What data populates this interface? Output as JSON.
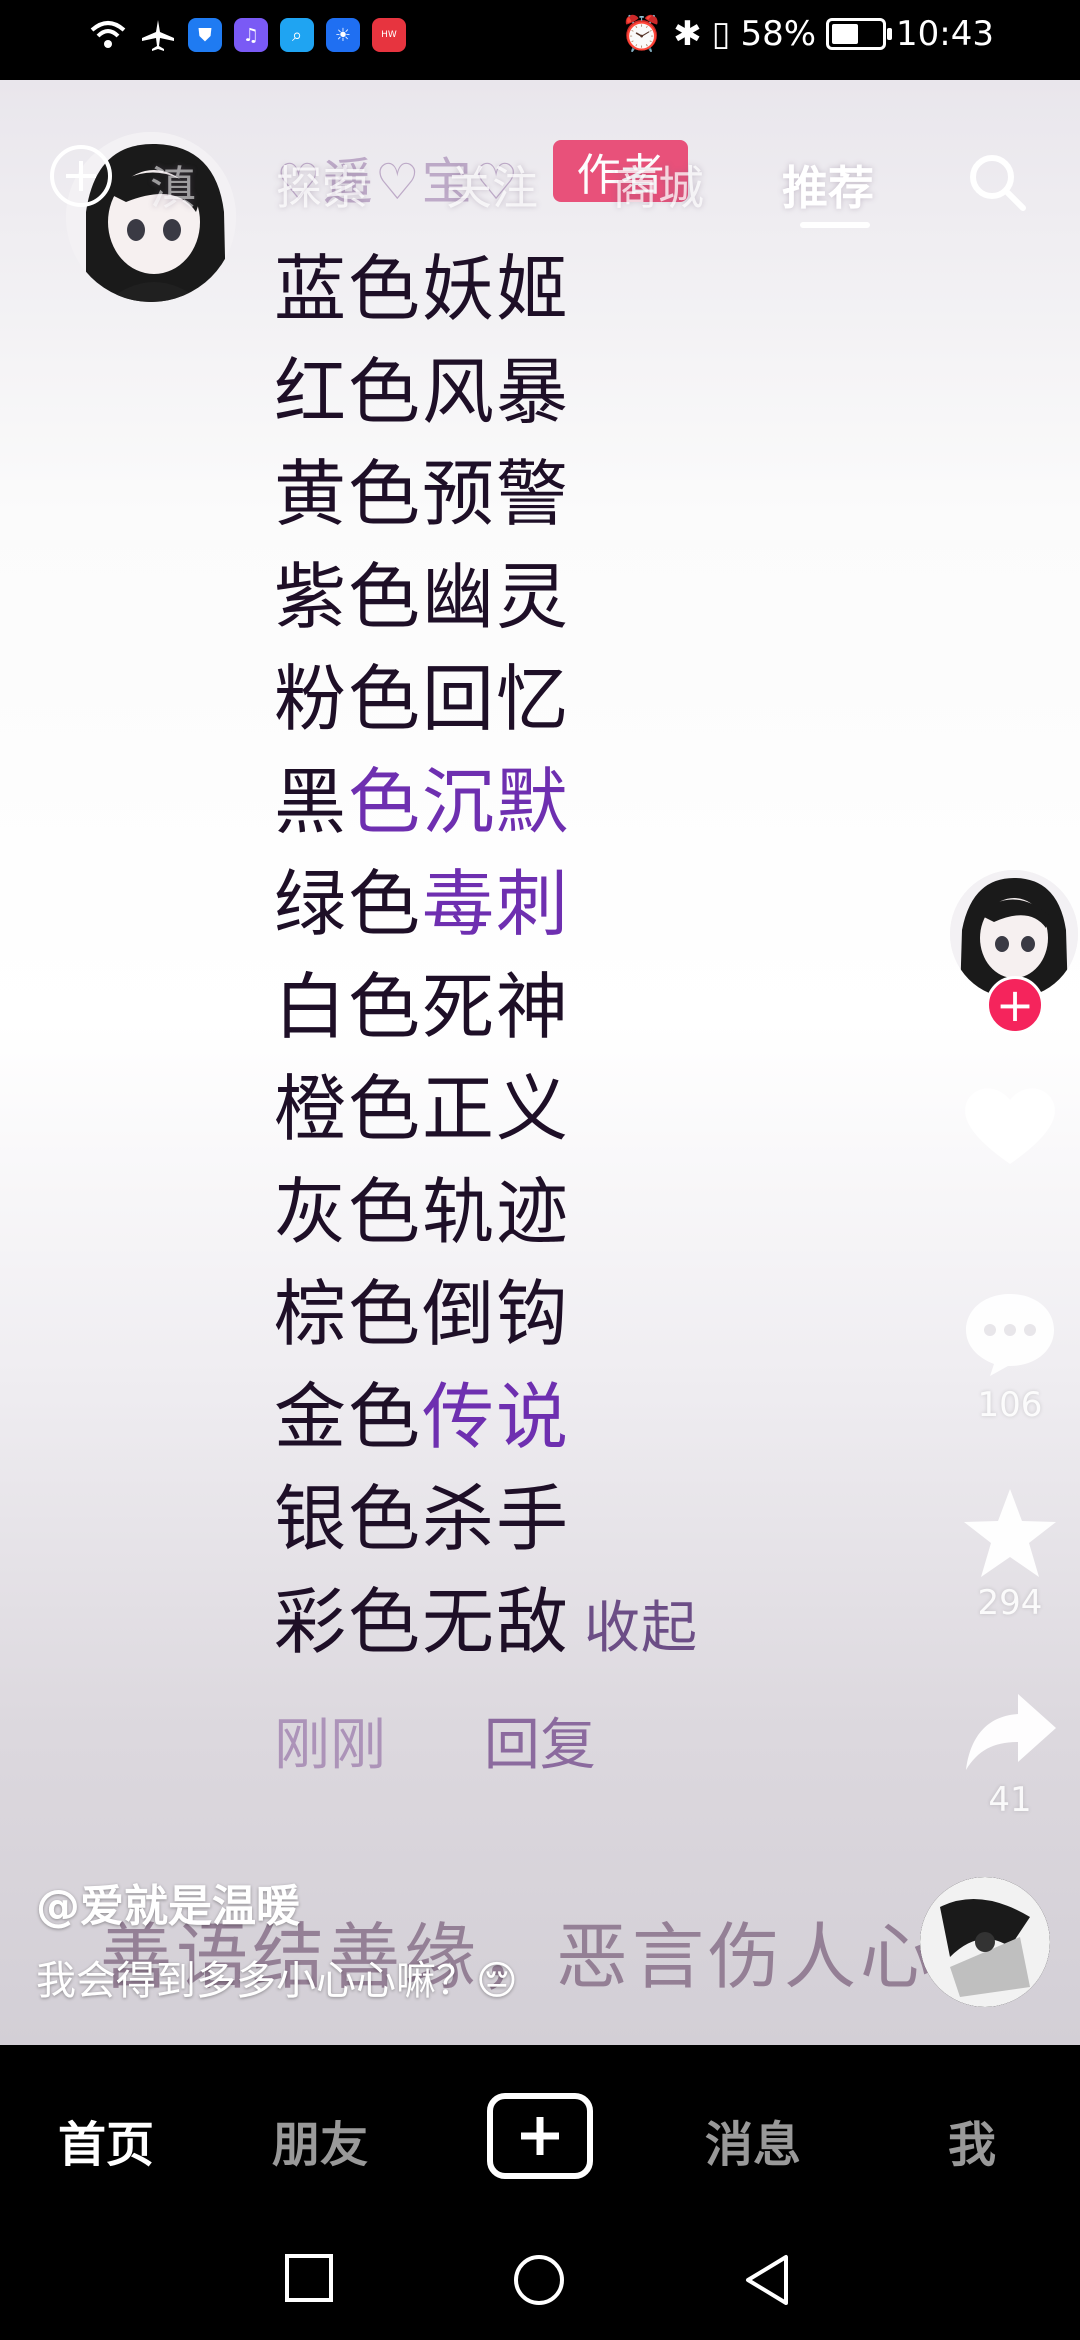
{
  "status_bar": {
    "battery": "58%",
    "battery_level": 0.58,
    "time": "10:43",
    "left_icons": [
      "wifi-icon",
      "airplane-icon",
      "shield-app-icon",
      "music-app-icon",
      "search-app-icon",
      "bulb-app-icon",
      "huawei-app-icon"
    ],
    "right_icons": [
      "alarm-icon",
      "bluetooth-icon",
      "vibrate-icon"
    ]
  },
  "top_nav": {
    "tabs": [
      "探索",
      "关注",
      "商城",
      "推荐"
    ],
    "partial_tab": "滇",
    "active_tab": "推荐"
  },
  "comment": {
    "author_line": "♡遥♡宝♡",
    "author_badge": "作者",
    "lines": [
      {
        "a": "蓝色妖姬",
        "b": ""
      },
      {
        "a": "红色风暴",
        "b": ""
      },
      {
        "a": "黄色预警",
        "b": ""
      },
      {
        "a": "紫色幽灵",
        "b": ""
      },
      {
        "a": "粉色回忆",
        "b": ""
      },
      {
        "a": "黑",
        "b": "色沉默"
      },
      {
        "a": "绿色",
        "b": "毒刺"
      },
      {
        "a": "白色死神",
        "b": ""
      },
      {
        "a": "橙色正义",
        "b": ""
      },
      {
        "a": "灰色轨迹",
        "b": ""
      },
      {
        "a": "棕色倒钩",
        "b": ""
      },
      {
        "a": "金色",
        "b": "传说"
      },
      {
        "a": "银色杀手",
        "b": ""
      },
      {
        "a": "彩色无敌",
        "b": ""
      }
    ],
    "collapse_label": "收起",
    "time": "刚刚",
    "reply_label": "回复"
  },
  "side_actions": {
    "like_count": "",
    "comment_count": "106",
    "favorite_count": "294",
    "share_count": "41"
  },
  "video_info": {
    "author": "@爱就是温暖",
    "description": "我会得到多多小心心嘛？😔",
    "caption_overlay": "善语结善缘，恶言伤人心"
  },
  "bottom_nav": {
    "home": "首页",
    "friends": "朋友",
    "messages": "消息",
    "me": "我"
  },
  "colors": {
    "accent_red": "#f5245c",
    "badge_pink": "#e8416e",
    "highlight_purple": "#6e2fb0"
  }
}
